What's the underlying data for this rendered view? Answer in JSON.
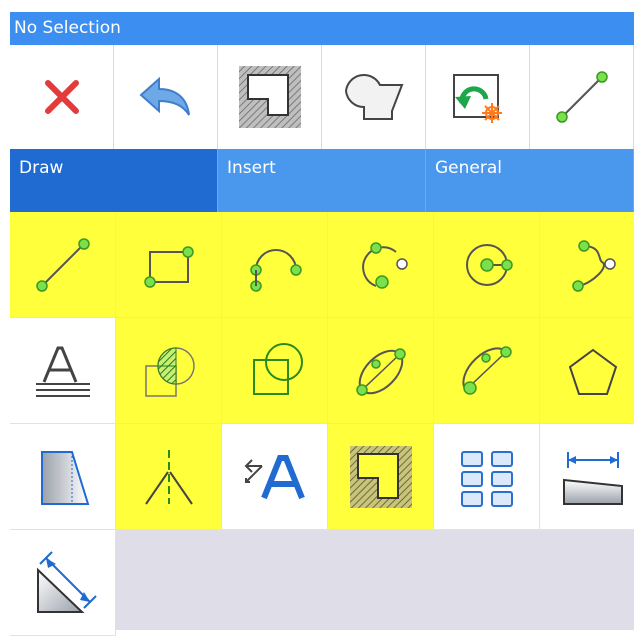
{
  "titlebar": {
    "text": "No Selection"
  },
  "toolbar": {
    "buttons": [
      {
        "icon": "close-icon"
      },
      {
        "icon": "undo-icon"
      },
      {
        "icon": "hatched-shape-icon"
      },
      {
        "icon": "union-shape-icon"
      },
      {
        "icon": "reload-icon"
      },
      {
        "icon": "line-icon"
      }
    ]
  },
  "tabs": [
    {
      "label": "Draw",
      "active": true
    },
    {
      "label": "Insert",
      "active": false
    },
    {
      "label": "General",
      "active": false
    }
  ],
  "tools": [
    {
      "icon": "line-tool-icon",
      "highlighted": true
    },
    {
      "icon": "rectangle-tool-icon",
      "highlighted": true
    },
    {
      "icon": "arc-tool-icon",
      "highlighted": true
    },
    {
      "icon": "three-point-arc-icon",
      "highlighted": true
    },
    {
      "icon": "circle-tool-icon",
      "highlighted": true
    },
    {
      "icon": "curve-tool-icon",
      "highlighted": true
    },
    {
      "icon": "text-tool-icon",
      "highlighted": false
    },
    {
      "icon": "hatch-circle-icon",
      "highlighted": true
    },
    {
      "icon": "region-icon",
      "highlighted": true
    },
    {
      "icon": "ellipse-tool-icon",
      "highlighted": true
    },
    {
      "icon": "elliptical-arc-icon",
      "highlighted": true
    },
    {
      "icon": "polygon-tool-icon",
      "highlighted": true
    },
    {
      "icon": "wedge-icon",
      "highlighted": false
    },
    {
      "icon": "centerline-icon",
      "highlighted": true
    },
    {
      "icon": "text-style-icon",
      "highlighted": false
    },
    {
      "icon": "hatch-fill-icon",
      "highlighted": true
    },
    {
      "icon": "array-grid-icon",
      "highlighted": false
    },
    {
      "icon": "linear-dimension-icon",
      "highlighted": false
    },
    {
      "icon": "aligned-dimension-icon",
      "highlighted": false
    }
  ],
  "colors": {
    "titlebar": "#3c8ff0",
    "tab_active": "#1f6bd1",
    "tab_bar": "#4a97ee",
    "highlight": "#ffff3c",
    "node_green": "#7be04b"
  }
}
